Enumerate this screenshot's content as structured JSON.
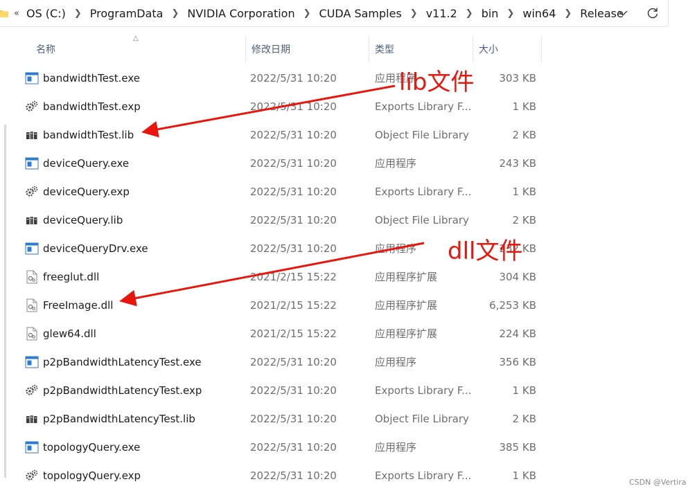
{
  "address": {
    "overflow": "«",
    "crumbs": [
      "OS (C:)",
      "ProgramData",
      "NVIDIA Corporation",
      "CUDA Samples",
      "v11.2",
      "bin",
      "win64",
      "Release"
    ]
  },
  "columns": {
    "name": "名称",
    "date": "修改日期",
    "type": "类型",
    "size": "大小"
  },
  "files": [
    {
      "name": "bandwidthTest.exe",
      "date": "2022/5/31 10:20",
      "type": "应用程序",
      "size": "303 KB",
      "icon": "exe-icon"
    },
    {
      "name": "bandwidthTest.exp",
      "date": "2022/5/31 10:20",
      "type": "Exports Library F...",
      "size": "1 KB",
      "icon": "exp-icon"
    },
    {
      "name": "bandwidthTest.lib",
      "date": "2022/5/31 10:20",
      "type": "Object File Library",
      "size": "2 KB",
      "icon": "lib-icon"
    },
    {
      "name": "deviceQuery.exe",
      "date": "2022/5/31 10:20",
      "type": "应用程序",
      "size": "243 KB",
      "icon": "exe-icon"
    },
    {
      "name": "deviceQuery.exp",
      "date": "2022/5/31 10:20",
      "type": "Exports Library F...",
      "size": "1 KB",
      "icon": "exp-icon"
    },
    {
      "name": "deviceQuery.lib",
      "date": "2022/5/31 10:20",
      "type": "Object File Library",
      "size": "2 KB",
      "icon": "lib-icon"
    },
    {
      "name": "deviceQueryDrv.exe",
      "date": "2022/5/31 10:20",
      "type": "应用程序",
      "size": "232 KB",
      "icon": "exe-icon"
    },
    {
      "name": "freeglut.dll",
      "date": "2021/2/15 15:22",
      "type": "应用程序扩展",
      "size": "304 KB",
      "icon": "dll-icon"
    },
    {
      "name": "FreeImage.dll",
      "date": "2021/2/15 15:22",
      "type": "应用程序扩展",
      "size": "6,253 KB",
      "icon": "dll-icon"
    },
    {
      "name": "glew64.dll",
      "date": "2021/2/15 15:22",
      "type": "应用程序扩展",
      "size": "224 KB",
      "icon": "dll-icon"
    },
    {
      "name": "p2pBandwidthLatencyTest.exe",
      "date": "2022/5/31 10:20",
      "type": "应用程序",
      "size": "356 KB",
      "icon": "exe-icon"
    },
    {
      "name": "p2pBandwidthLatencyTest.exp",
      "date": "2022/5/31 10:20",
      "type": "Exports Library F...",
      "size": "1 KB",
      "icon": "exp-icon"
    },
    {
      "name": "p2pBandwidthLatencyTest.lib",
      "date": "2022/5/31 10:20",
      "type": "Object File Library",
      "size": "2 KB",
      "icon": "lib-icon"
    },
    {
      "name": "topologyQuery.exe",
      "date": "2022/5/31 10:20",
      "type": "应用程序",
      "size": "385 KB",
      "icon": "exe-icon"
    },
    {
      "name": "topologyQuery.exp",
      "date": "2022/5/31 10:20",
      "type": "Exports Library F...",
      "size": "1 KB",
      "icon": "exp-icon"
    }
  ],
  "annotations": {
    "lib_label": "lib文件",
    "dll_label": "dll文件",
    "color": "#e8160c"
  },
  "watermark": "CSDN @Vertira"
}
